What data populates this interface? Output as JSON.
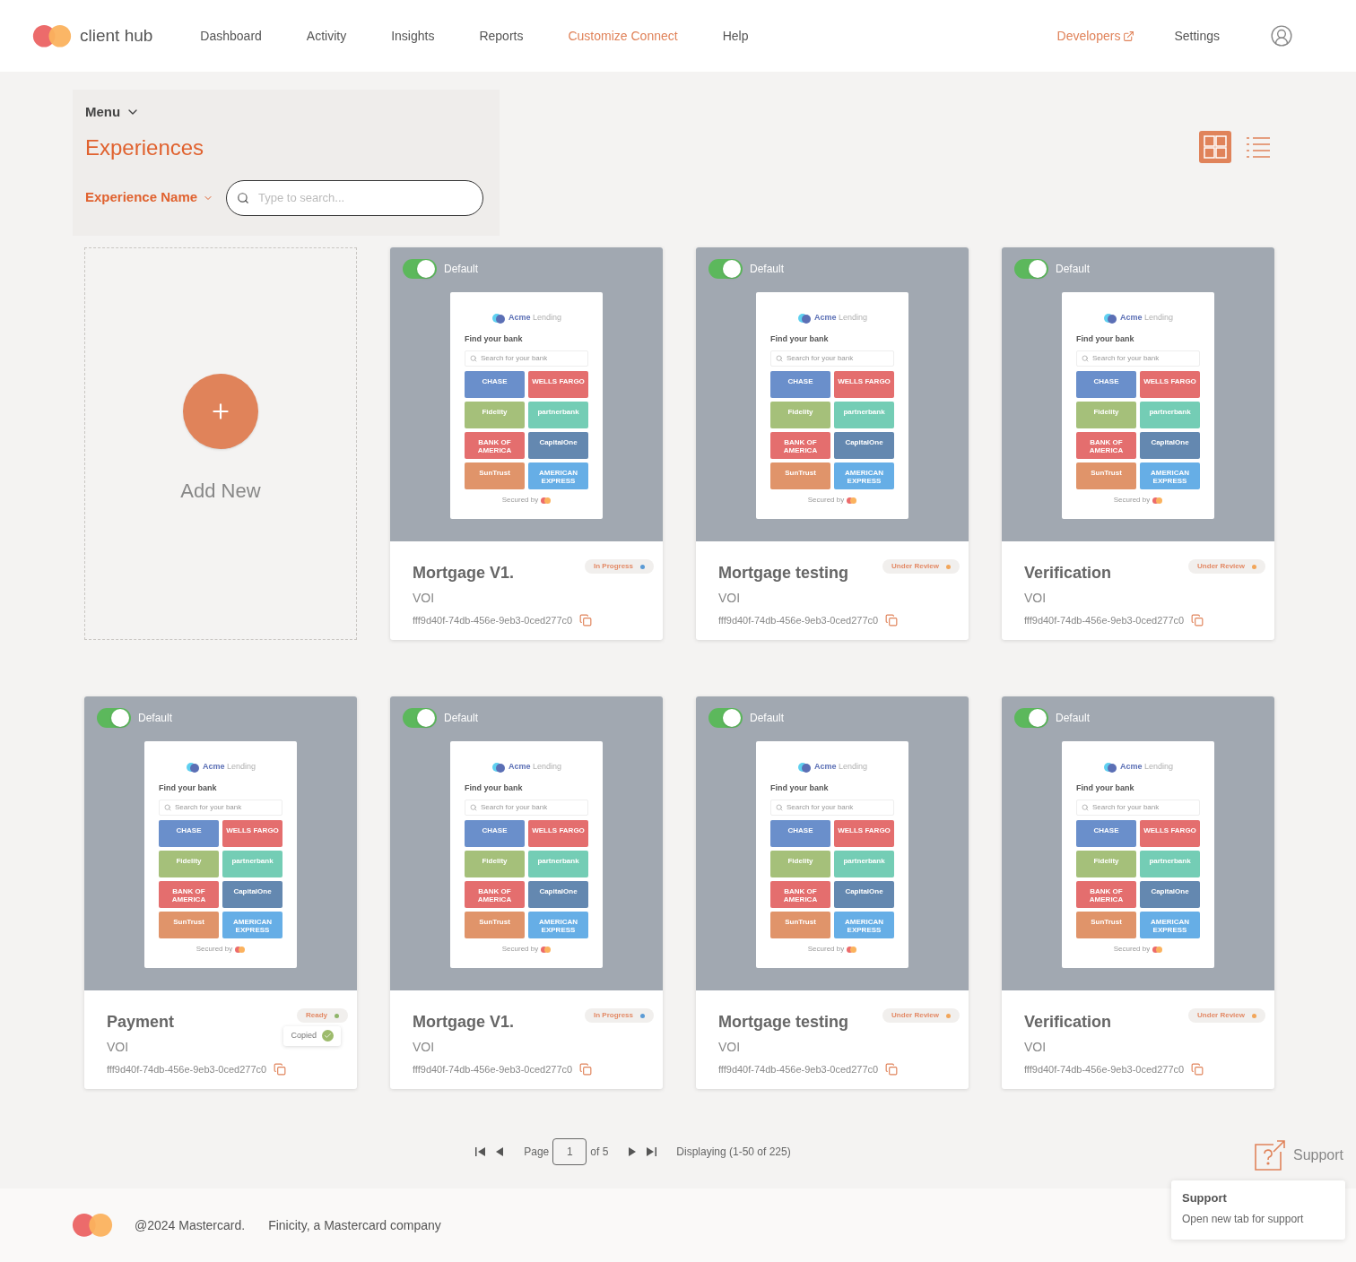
{
  "header": {
    "brand": "client hub",
    "nav": [
      {
        "label": "Dashboard",
        "selected": false
      },
      {
        "label": "Activity",
        "selected": false
      },
      {
        "label": "Insights",
        "selected": false
      },
      {
        "label": "Reports",
        "selected": false
      },
      {
        "label": "Customize Connect",
        "selected": true
      },
      {
        "label": "Help",
        "selected": false
      }
    ],
    "right_nav": [
      {
        "label": "Developers",
        "kind": "external"
      },
      {
        "label": "Settings",
        "kind": "plain"
      }
    ]
  },
  "filter_panel": {
    "menu": "Menu",
    "title": "Experiences",
    "filter_label": "Experience Name",
    "search": {
      "placeholder": "Type to search..."
    }
  },
  "views": [
    {
      "kind": "grid",
      "selected": true
    },
    {
      "kind": "list",
      "selected": false
    }
  ],
  "add_new": {
    "label": "Add New"
  },
  "cards": [
    {
      "toggle": {
        "on": true,
        "label": "Default"
      },
      "preview": {
        "brand": "Acme",
        "brand_suffix": "Lending",
        "heading": "Find your bank",
        "search_placeholder": "Search for your bank",
        "banks": [
          {
            "label": "CHASE",
            "color": "#6a8fcb"
          },
          {
            "label": "WELLS FARGO",
            "color": "#e46e6e"
          },
          {
            "label": "Fidelity",
            "color": "#a5c07a"
          },
          {
            "label": "partnerbank",
            "color": "#74cdb5"
          },
          {
            "label": "BANK OF AMERICA",
            "color": "#e46e6e"
          },
          {
            "label": "CapitalOne",
            "color": "#6488b0"
          },
          {
            "label": "SunTrust",
            "color": "#e0946a"
          },
          {
            "label": "AMERICAN EXPRESS",
            "color": "#66aee6"
          }
        ],
        "footer": "Secured by"
      },
      "title": "Mortgage V1.",
      "type": "VOI",
      "id": "fff9d40f-74db-456e-9eb3-0ced277c0",
      "status": {
        "label": "In Progress",
        "color": "#5b9bd5"
      }
    },
    {
      "toggle": {
        "on": true,
        "label": "Default"
      },
      "preview": {
        "brand": "Acme",
        "brand_suffix": "Lending",
        "heading": "Find your bank",
        "search_placeholder": "Search for your bank",
        "banks": [
          {
            "label": "CHASE",
            "color": "#6a8fcb"
          },
          {
            "label": "WELLS FARGO",
            "color": "#e46e6e"
          },
          {
            "label": "Fidelity",
            "color": "#a5c07a"
          },
          {
            "label": "partnerbank",
            "color": "#74cdb5"
          },
          {
            "label": "BANK OF AMERICA",
            "color": "#e46e6e"
          },
          {
            "label": "CapitalOne",
            "color": "#6488b0"
          },
          {
            "label": "SunTrust",
            "color": "#e0946a"
          },
          {
            "label": "AMERICAN EXPRESS",
            "color": "#66aee6"
          }
        ],
        "footer": "Secured by"
      },
      "title": "Mortgage testing",
      "type": "VOI",
      "id": "fff9d40f-74db-456e-9eb3-0ced277c0",
      "status": {
        "label": "Under Review",
        "color": "#f2a65a"
      }
    },
    {
      "toggle": {
        "on": true,
        "label": "Default"
      },
      "preview": {
        "brand": "Acme",
        "brand_suffix": "Lending",
        "heading": "Find your bank",
        "search_placeholder": "Search for your bank",
        "banks": [
          {
            "label": "CHASE",
            "color": "#6a8fcb"
          },
          {
            "label": "WELLS FARGO",
            "color": "#e46e6e"
          },
          {
            "label": "Fidelity",
            "color": "#a5c07a"
          },
          {
            "label": "partnerbank",
            "color": "#74cdb5"
          },
          {
            "label": "BANK OF AMERICA",
            "color": "#e46e6e"
          },
          {
            "label": "CapitalOne",
            "color": "#6488b0"
          },
          {
            "label": "SunTrust",
            "color": "#e0946a"
          },
          {
            "label": "AMERICAN EXPRESS",
            "color": "#66aee6"
          }
        ],
        "footer": "Secured by"
      },
      "title": "Verification",
      "type": "VOI",
      "id": "fff9d40f-74db-456e-9eb3-0ced277c0",
      "status": {
        "label": "Under Review",
        "color": "#f2a65a"
      }
    },
    {
      "toggle": {
        "on": true,
        "label": "Default"
      },
      "preview": {
        "brand": "Acme",
        "brand_suffix": "Lending",
        "heading": "Find your bank",
        "search_placeholder": "Search for your bank",
        "banks": [
          {
            "label": "CHASE",
            "color": "#6a8fcb"
          },
          {
            "label": "WELLS FARGO",
            "color": "#e46e6e"
          },
          {
            "label": "Fidelity",
            "color": "#a5c07a"
          },
          {
            "label": "partnerbank",
            "color": "#74cdb5"
          },
          {
            "label": "BANK OF AMERICA",
            "color": "#e46e6e"
          },
          {
            "label": "CapitalOne",
            "color": "#6488b0"
          },
          {
            "label": "SunTrust",
            "color": "#e0946a"
          },
          {
            "label": "AMERICAN EXPRESS",
            "color": "#66aee6"
          }
        ],
        "footer": "Secured by"
      },
      "title": "Payment",
      "type": "VOI",
      "id": "fff9d40f-74db-456e-9eb3-0ced277c0",
      "status": {
        "label": "Ready",
        "color": "#8fb56a"
      },
      "copy_tooltip": "Copied"
    },
    {
      "toggle": {
        "on": true,
        "label": "Default"
      },
      "preview": {
        "brand": "Acme",
        "brand_suffix": "Lending",
        "heading": "Find your bank",
        "search_placeholder": "Search for your bank",
        "banks": [
          {
            "label": "CHASE",
            "color": "#6a8fcb"
          },
          {
            "label": "WELLS FARGO",
            "color": "#e46e6e"
          },
          {
            "label": "Fidelity",
            "color": "#a5c07a"
          },
          {
            "label": "partnerbank",
            "color": "#74cdb5"
          },
          {
            "label": "BANK OF AMERICA",
            "color": "#e46e6e"
          },
          {
            "label": "CapitalOne",
            "color": "#6488b0"
          },
          {
            "label": "SunTrust",
            "color": "#e0946a"
          },
          {
            "label": "AMERICAN EXPRESS",
            "color": "#66aee6"
          }
        ],
        "footer": "Secured by"
      },
      "title": "Mortgage V1.",
      "type": "VOI",
      "id": "fff9d40f-74db-456e-9eb3-0ced277c0",
      "status": {
        "label": "In Progress",
        "color": "#5b9bd5"
      }
    },
    {
      "toggle": {
        "on": true,
        "label": "Default"
      },
      "preview": {
        "brand": "Acme",
        "brand_suffix": "Lending",
        "heading": "Find your bank",
        "search_placeholder": "Search for your bank",
        "banks": [
          {
            "label": "CHASE",
            "color": "#6a8fcb"
          },
          {
            "label": "WELLS FARGO",
            "color": "#e46e6e"
          },
          {
            "label": "Fidelity",
            "color": "#a5c07a"
          },
          {
            "label": "partnerbank",
            "color": "#74cdb5"
          },
          {
            "label": "BANK OF AMERICA",
            "color": "#e46e6e"
          },
          {
            "label": "CapitalOne",
            "color": "#6488b0"
          },
          {
            "label": "SunTrust",
            "color": "#e0946a"
          },
          {
            "label": "AMERICAN EXPRESS",
            "color": "#66aee6"
          }
        ],
        "footer": "Secured by"
      },
      "title": "Mortgage testing",
      "type": "VOI",
      "id": "fff9d40f-74db-456e-9eb3-0ced277c0",
      "status": {
        "label": "Under Review",
        "color": "#f2a65a"
      }
    },
    {
      "toggle": {
        "on": true,
        "label": "Default"
      },
      "preview": {
        "brand": "Acme",
        "brand_suffix": "Lending",
        "heading": "Find your bank",
        "search_placeholder": "Search for your bank",
        "banks": [
          {
            "label": "CHASE",
            "color": "#6a8fcb"
          },
          {
            "label": "WELLS FARGO",
            "color": "#e46e6e"
          },
          {
            "label": "Fidelity",
            "color": "#a5c07a"
          },
          {
            "label": "partnerbank",
            "color": "#74cdb5"
          },
          {
            "label": "BANK OF AMERICA",
            "color": "#e46e6e"
          },
          {
            "label": "CapitalOne",
            "color": "#6488b0"
          },
          {
            "label": "SunTrust",
            "color": "#e0946a"
          },
          {
            "label": "AMERICAN EXPRESS",
            "color": "#66aee6"
          }
        ],
        "footer": "Secured by"
      },
      "title": "Verification",
      "type": "VOI",
      "id": "fff9d40f-74db-456e-9eb3-0ced277c0",
      "status": {
        "label": "Under Review",
        "color": "#f2a65a"
      }
    }
  ],
  "pagination": {
    "page_label": "Page",
    "page": "1",
    "of": "of 5",
    "displaying": "Displaying (1-50 of 225)"
  },
  "footer": {
    "copyright": "@2024 Mastercard.",
    "company": "Finicity, a Mastercard company"
  },
  "support": {
    "label": "Support",
    "tooltip_title": "Support",
    "tooltip_text": "Open new tab for support"
  }
}
